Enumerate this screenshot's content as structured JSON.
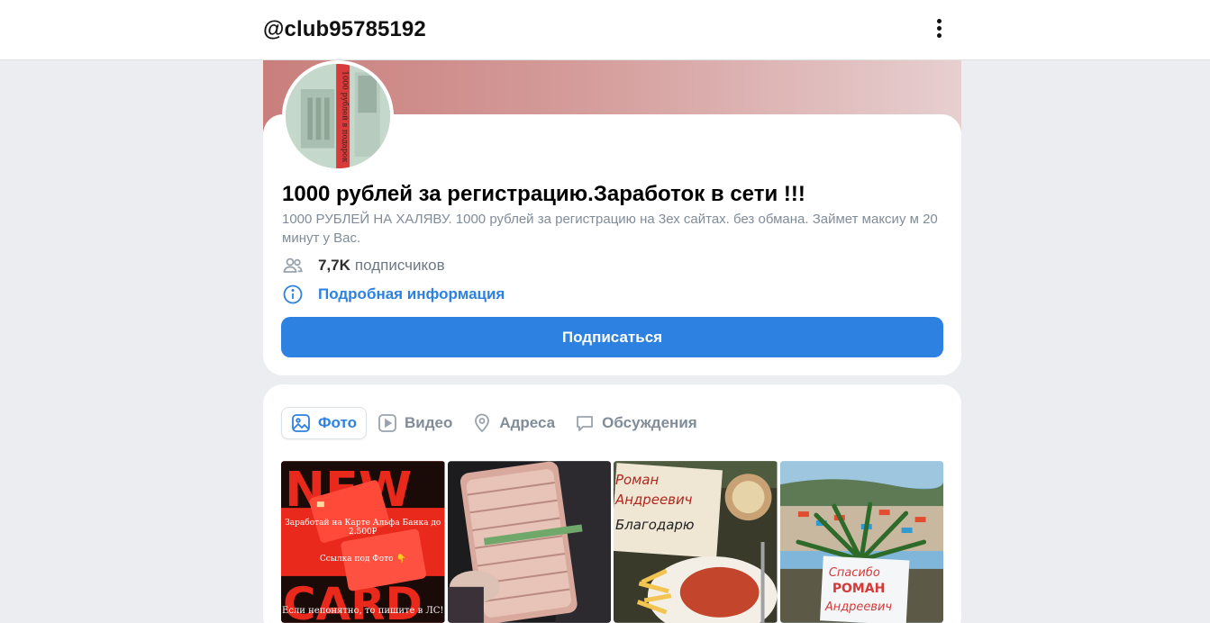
{
  "header": {
    "handle": "@club95785192",
    "menu_icon": "more-vertical-icon"
  },
  "group": {
    "title": "1000 рублей за регистрацию.Заработок в сети !!!",
    "description": "1000 РУБЛЕЙ НА ХАЛЯВУ. 1000 рублей за регистрацию на 3ех сайтах. без обмана. Займет максиу м 20 минут у Вас.",
    "subscribers_count": "7,7K",
    "subscribers_label": "подписчиков",
    "info_link": "Подробная информация",
    "subscribe_button": "Подписаться",
    "avatar_text": "1000 рублей в подарок"
  },
  "tabs": [
    {
      "label": "Фото",
      "icon": "photo-icon",
      "active": true
    },
    {
      "label": "Видео",
      "icon": "video-icon",
      "active": false
    },
    {
      "label": "Адреса",
      "icon": "location-pin-icon",
      "active": false
    },
    {
      "label": "Обсуждения",
      "icon": "chat-bubble-icon",
      "active": false
    }
  ],
  "photos": {
    "tile1": {
      "big_top": "NEW",
      "big_bottom": "CARD",
      "caption_1": "Заработай на Карте Альфа Банка до 2.500₽",
      "caption_2": "Ссылка под Фото 👇",
      "caption_bottom": "Если непонятно, то пишите в ЛС!"
    },
    "tile3": {
      "note_line1": "Роман",
      "note_line2": "Андреевич",
      "note_line3": "Благодарю"
    },
    "tile4": {
      "sign_line1": "Спасибо",
      "sign_line2": "РОМАН",
      "sign_line3": "Андреевич"
    }
  },
  "colors": {
    "accent": "#2d81e0",
    "muted": "#818c99",
    "background": "#ebedf0"
  }
}
